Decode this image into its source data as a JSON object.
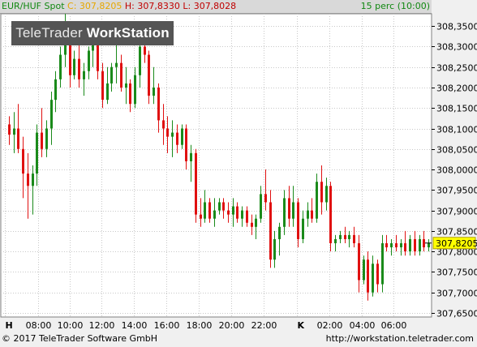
{
  "header": {
    "symbol": "EUR/HUF Spot",
    "close": "C: 307,8205",
    "high": "H: 307,8330",
    "low": "L: 307,8028",
    "period": "15 perc (10:00)"
  },
  "watermark": {
    "part1": "TeleTrader",
    "part2": "WorkStation"
  },
  "footer": {
    "copyright": "© 2017 TeleTrader Software GmbH",
    "url": "http://workstation.teletrader.com"
  },
  "colors": {
    "up": "#1a8a1a",
    "down": "#e01010",
    "plot_bg": "#ffffff",
    "grid": "#c8c8c8",
    "last_price_bg": "#ffff00"
  },
  "chart_data": {
    "type": "candlestick",
    "title": "",
    "ylim": [
      307.64,
      308.38
    ],
    "y_ticks": [
      "308,3500",
      "308,3000",
      "308,2500",
      "308,2000",
      "308,1500",
      "308,1000",
      "308,0500",
      "308,0000",
      "307,9500",
      "307,9000",
      "307,8500",
      "307,8000",
      "307,7500",
      "307,7000",
      "307,6500"
    ],
    "x_ticks": [
      "H",
      "08:00",
      "10:00",
      "12:00",
      "14:00",
      "16:00",
      "18:00",
      "20:00",
      "22:00",
      "K",
      "02:00",
      "04:00",
      "06:00"
    ],
    "last_price": "307,8205",
    "grid": true,
    "candles": [
      [
        308.11,
        308.13,
        308.06,
        308.085
      ],
      [
        308.085,
        308.14,
        308.04,
        308.1
      ],
      [
        308.1,
        308.16,
        308.04,
        308.05
      ],
      [
        308.05,
        308.08,
        307.93,
        307.99
      ],
      [
        307.99,
        308.04,
        307.88,
        307.96
      ],
      [
        307.96,
        308.01,
        307.89,
        307.99
      ],
      [
        307.99,
        308.11,
        307.96,
        308.09
      ],
      [
        308.09,
        308.15,
        308.03,
        308.05
      ],
      [
        308.05,
        308.12,
        308.03,
        308.1
      ],
      [
        308.1,
        308.19,
        308.06,
        308.17
      ],
      [
        308.17,
        308.24,
        308.14,
        308.22
      ],
      [
        308.22,
        308.3,
        308.2,
        308.28
      ],
      [
        308.28,
        308.38,
        308.25,
        308.31
      ],
      [
        308.31,
        308.33,
        308.2,
        308.23
      ],
      [
        308.23,
        308.29,
        308.22,
        308.27
      ],
      [
        308.27,
        308.32,
        308.2,
        308.22
      ],
      [
        308.22,
        308.26,
        308.18,
        308.24
      ],
      [
        308.24,
        308.3,
        308.22,
        308.29
      ],
      [
        308.29,
        308.34,
        308.25,
        308.32
      ],
      [
        308.32,
        308.33,
        308.22,
        308.24
      ],
      [
        308.24,
        308.26,
        308.15,
        308.17
      ],
      [
        308.17,
        308.25,
        308.16,
        308.21
      ],
      [
        308.21,
        308.26,
        308.19,
        308.25
      ],
      [
        308.25,
        308.31,
        308.21,
        308.26
      ],
      [
        308.26,
        308.28,
        308.19,
        308.2
      ],
      [
        308.2,
        308.25,
        308.16,
        308.21
      ],
      [
        308.21,
        308.22,
        308.14,
        308.16
      ],
      [
        308.16,
        308.25,
        308.15,
        308.23
      ],
      [
        308.23,
        308.32,
        308.2,
        308.3
      ],
      [
        308.3,
        308.34,
        308.26,
        308.28
      ],
      [
        308.28,
        308.29,
        308.16,
        308.18
      ],
      [
        308.18,
        308.25,
        308.16,
        308.2
      ],
      [
        308.2,
        308.21,
        308.09,
        308.12
      ],
      [
        308.12,
        308.16,
        308.06,
        308.1
      ],
      [
        308.1,
        308.13,
        308.04,
        308.08
      ],
      [
        308.08,
        308.12,
        308.03,
        308.09
      ],
      [
        308.09,
        308.11,
        308.04,
        308.06
      ],
      [
        308.06,
        308.11,
        308.05,
        308.1
      ],
      [
        308.1,
        308.11,
        308.0,
        308.02
      ],
      [
        308.02,
        308.06,
        307.97,
        308.04
      ],
      [
        308.04,
        308.05,
        307.87,
        307.89
      ],
      [
        307.89,
        307.93,
        307.86,
        307.88
      ],
      [
        307.88,
        307.95,
        307.87,
        307.92
      ],
      [
        307.92,
        307.93,
        307.87,
        307.88
      ],
      [
        307.88,
        307.93,
        307.86,
        307.9
      ],
      [
        307.9,
        307.93,
        307.89,
        307.92
      ],
      [
        307.92,
        307.93,
        307.88,
        307.9
      ],
      [
        307.9,
        307.92,
        307.87,
        307.89
      ],
      [
        307.89,
        307.93,
        307.86,
        307.91
      ],
      [
        307.91,
        307.92,
        307.87,
        307.88
      ],
      [
        307.88,
        307.91,
        307.86,
        307.9
      ],
      [
        307.9,
        307.91,
        307.86,
        307.87
      ],
      [
        307.87,
        307.89,
        307.84,
        307.86
      ],
      [
        307.86,
        307.89,
        307.83,
        307.88
      ],
      [
        307.88,
        307.96,
        307.87,
        307.94
      ],
      [
        307.94,
        308.0,
        307.9,
        307.92
      ],
      [
        307.92,
        307.95,
        307.76,
        307.78
      ],
      [
        307.78,
        307.85,
        307.76,
        307.83
      ],
      [
        307.83,
        307.87,
        307.79,
        307.86
      ],
      [
        307.86,
        307.95,
        307.84,
        307.93
      ],
      [
        307.93,
        307.96,
        307.86,
        307.88
      ],
      [
        307.88,
        307.96,
        307.86,
        307.92
      ],
      [
        307.92,
        307.93,
        307.81,
        307.83
      ],
      [
        307.83,
        307.9,
        307.82,
        307.88
      ],
      [
        307.88,
        307.92,
        307.86,
        307.9
      ],
      [
        307.9,
        307.93,
        307.87,
        307.88
      ],
      [
        307.88,
        307.99,
        307.87,
        307.97
      ],
      [
        307.97,
        308.01,
        307.89,
        307.92
      ],
      [
        307.92,
        307.98,
        307.9,
        307.96
      ],
      [
        307.96,
        307.97,
        307.8,
        307.82
      ],
      [
        307.82,
        307.84,
        307.8,
        307.83
      ],
      [
        307.83,
        307.85,
        307.82,
        307.84
      ],
      [
        307.84,
        307.86,
        307.82,
        307.83
      ],
      [
        307.83,
        307.85,
        307.81,
        307.84
      ],
      [
        307.84,
        307.86,
        307.81,
        307.82
      ],
      [
        307.82,
        307.84,
        307.7,
        307.73
      ],
      [
        307.73,
        307.79,
        307.72,
        307.78
      ],
      [
        307.78,
        307.8,
        307.68,
        307.7
      ],
      [
        307.7,
        307.79,
        307.69,
        307.77
      ],
      [
        307.77,
        307.78,
        307.7,
        307.72
      ],
      [
        307.72,
        307.84,
        307.7,
        307.82
      ],
      [
        307.82,
        307.84,
        307.8,
        307.81
      ],
      [
        307.81,
        307.83,
        307.79,
        307.82
      ],
      [
        307.82,
        307.84,
        307.8,
        307.81
      ],
      [
        307.81,
        307.83,
        307.79,
        307.82
      ],
      [
        307.82,
        307.85,
        307.79,
        307.8
      ],
      [
        307.8,
        307.84,
        307.79,
        307.83
      ],
      [
        307.83,
        307.85,
        307.79,
        307.8
      ],
      [
        307.8,
        307.84,
        307.79,
        307.83
      ],
      [
        307.83,
        307.85,
        307.8,
        307.81
      ],
      [
        307.81,
        307.83,
        307.8,
        307.82
      ]
    ]
  }
}
